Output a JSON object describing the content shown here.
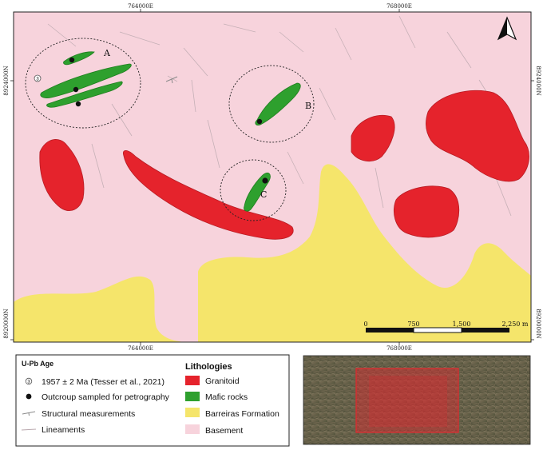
{
  "map": {
    "grid_labels": {
      "top": [
        "764000E",
        "768000E"
      ],
      "bottom": [
        "764000E",
        "768000E"
      ],
      "left": [
        "8924000N",
        "8920000N"
      ],
      "right": [
        "8924000N",
        "8920000N"
      ]
    },
    "sites": [
      {
        "label": "A"
      },
      {
        "label": "B"
      },
      {
        "label": "C"
      }
    ],
    "age_marker_label": "3",
    "scale_bar": {
      "ticks": [
        "0",
        "750",
        "1,500",
        "2,250 m"
      ]
    }
  },
  "legend": {
    "upb_title": "U-Pb Age",
    "upb_items": [
      {
        "icon": "age-circle-icon",
        "label": "1957 ± 2 Ma (Tesser et al., 2021)",
        "glyph": "3"
      },
      {
        "icon": "black-dot-icon",
        "label": "Outcroup sampled for petrography"
      },
      {
        "icon": "structural-symbol-icon",
        "label": "Structural measurements"
      },
      {
        "icon": "lineament-icon",
        "label": "Lineaments"
      }
    ],
    "litho_title": "Lithologies",
    "litho_items": [
      {
        "label": "Granitoid",
        "color": "#e5232c"
      },
      {
        "label": "Mafic rocks",
        "color": "#2ea02e"
      },
      {
        "label": "Barreiras Formation",
        "color": "#f5e56b"
      },
      {
        "label": "Basement",
        "color": "#f7d3dc"
      }
    ]
  },
  "colors": {
    "basement": "#f7d3dc",
    "granitoid": "#e5232c",
    "mafic": "#2ea02e",
    "barreiras": "#f5e56b",
    "inset_highlight": "#e0282e"
  }
}
